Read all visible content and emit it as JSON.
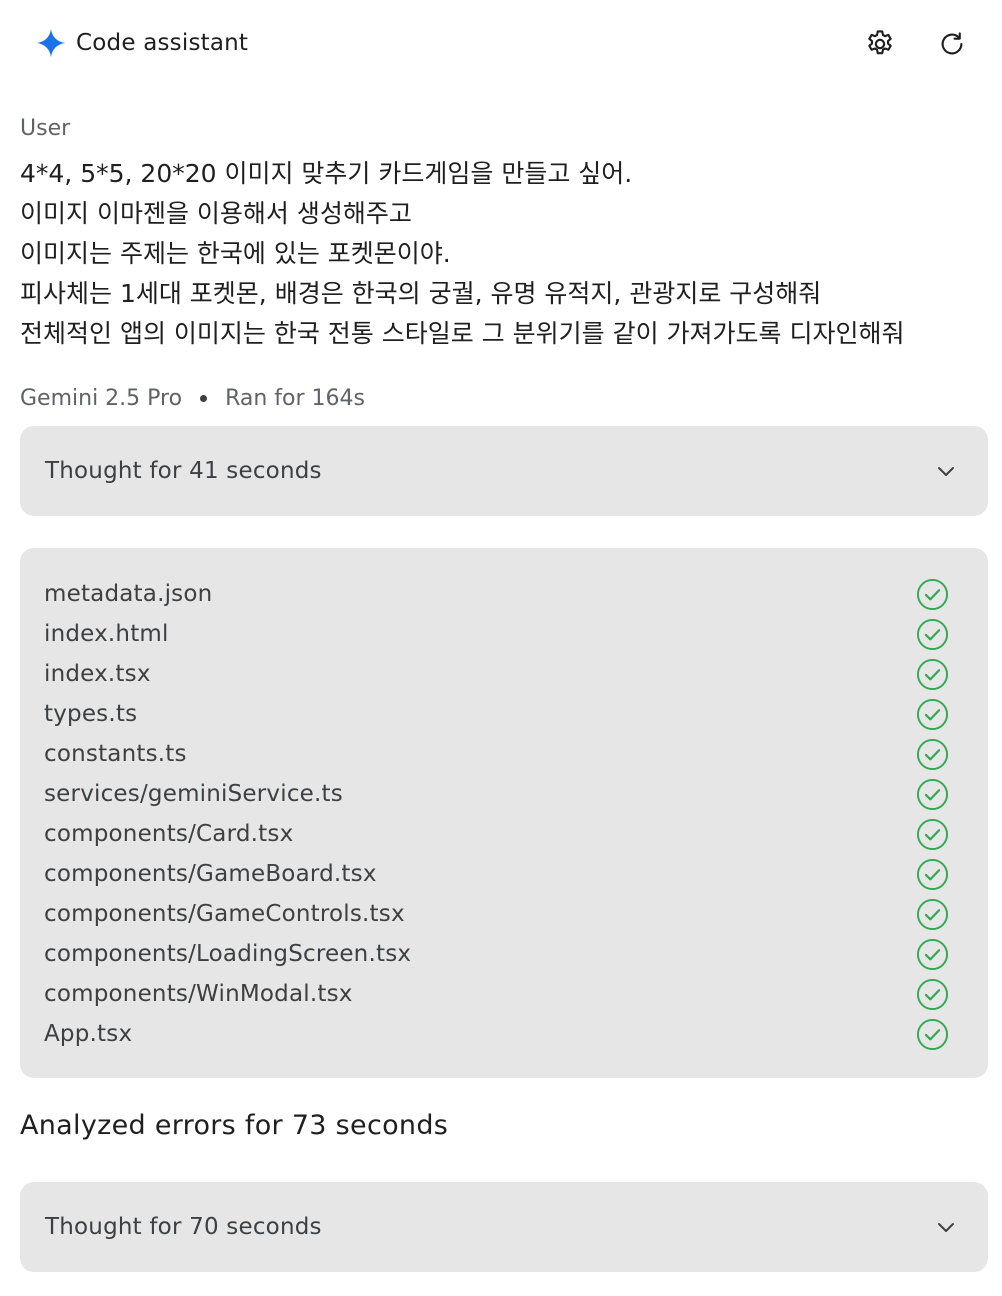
{
  "header": {
    "title": "Code assistant",
    "brand_icon": "sparkle-icon",
    "brand_color": "#1a73e8",
    "buttons": [
      "settings-icon",
      "refresh-icon"
    ]
  },
  "message": {
    "role": "User",
    "lines": [
      "4*4, 5*5, 20*20 이미지 맞추기 카드게임을 만들고 싶어.",
      "이미지 이마젠을 이용해서 생성해주고",
      "이미지는 주제는 한국에 있는 포켓몬이야.",
      "피사체는 1세대 포켓몬, 배경은 한국의 궁궐, 유명 유적지, 관광지로 구성해줘",
      "전체적인 앱의 이미지는 한국 전통 스타일로 그 분위기를 같이 가져가도록 디자인해줘"
    ]
  },
  "meta": {
    "model": "Gemini 2.5 Pro",
    "run_time": "Ran for 164s"
  },
  "thought_1": {
    "label": "Thought for 41 seconds"
  },
  "files": {
    "status_color": "#34a853",
    "items": [
      {
        "name": "metadata.json",
        "status": "done"
      },
      {
        "name": "index.html",
        "status": "done"
      },
      {
        "name": "index.tsx",
        "status": "done"
      },
      {
        "name": "types.ts",
        "status": "done"
      },
      {
        "name": "constants.ts",
        "status": "done"
      },
      {
        "name": "services/geminiService.ts",
        "status": "done"
      },
      {
        "name": "components/Card.tsx",
        "status": "done"
      },
      {
        "name": "components/GameBoard.tsx",
        "status": "done"
      },
      {
        "name": "components/GameControls.tsx",
        "status": "done"
      },
      {
        "name": "components/LoadingScreen.tsx",
        "status": "done"
      },
      {
        "name": "components/WinModal.tsx",
        "status": "done"
      },
      {
        "name": "App.tsx",
        "status": "done"
      }
    ]
  },
  "analysis": {
    "heading": "Analyzed errors for 73 seconds"
  },
  "thought_2": {
    "label": "Thought for 70 seconds"
  }
}
